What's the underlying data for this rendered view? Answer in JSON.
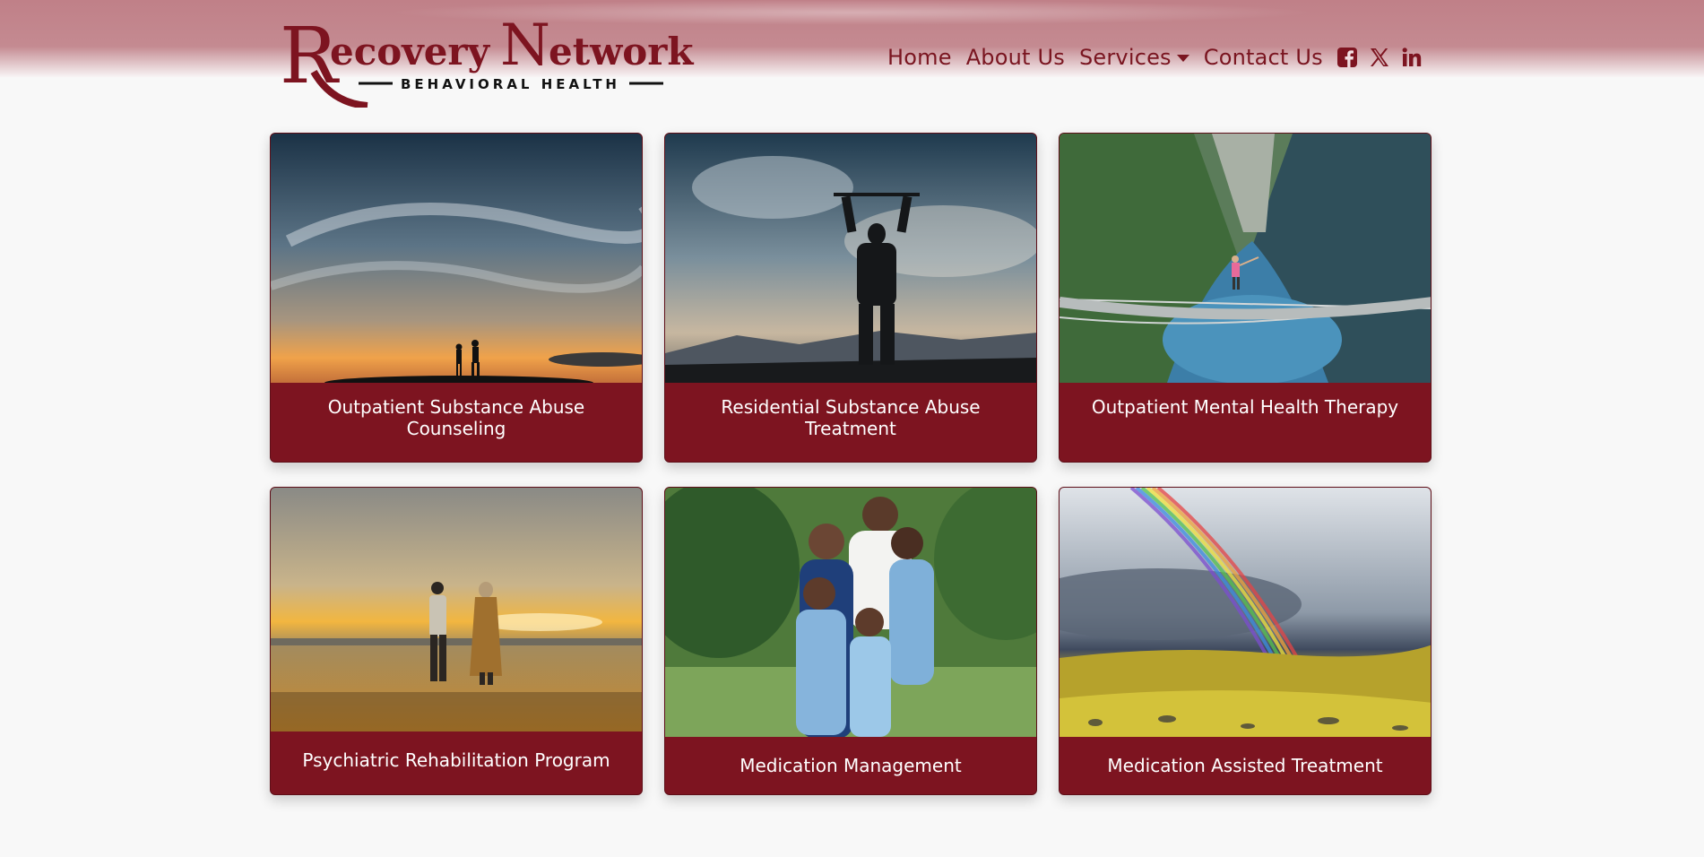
{
  "brand": {
    "logo_word1": "ecovery",
    "logo_initial1": "R",
    "logo_initial2": "N",
    "logo_word2": "etwork",
    "logo_tagline": "BEHAVIORAL HEALTH",
    "primary_color": "#7d1420"
  },
  "nav": {
    "home": "Home",
    "about": "About Us",
    "services": "Services",
    "contact": "Contact Us",
    "social_icons": [
      "facebook-square-icon",
      "x-twitter-icon",
      "linkedin-icon"
    ]
  },
  "services": [
    {
      "title": "Outpatient Substance Abuse Counseling",
      "image": "silhouette couple at sunset under cloudy sky"
    },
    {
      "title": "Residential Substance Abuse Treatment",
      "image": "man raising bar overhead against clouds"
    },
    {
      "title": "Outpatient Mental Health Therapy",
      "image": "woman on suspension bridge over mountain lake"
    },
    {
      "title": "Psychiatric Rehabilitation Program",
      "image": "couple holding hands on beach at sunset"
    },
    {
      "title": "Medication Management",
      "image": "family hugging outdoors"
    },
    {
      "title": "Medication Assisted Treatment",
      "image": "rainbow over golden field"
    }
  ]
}
